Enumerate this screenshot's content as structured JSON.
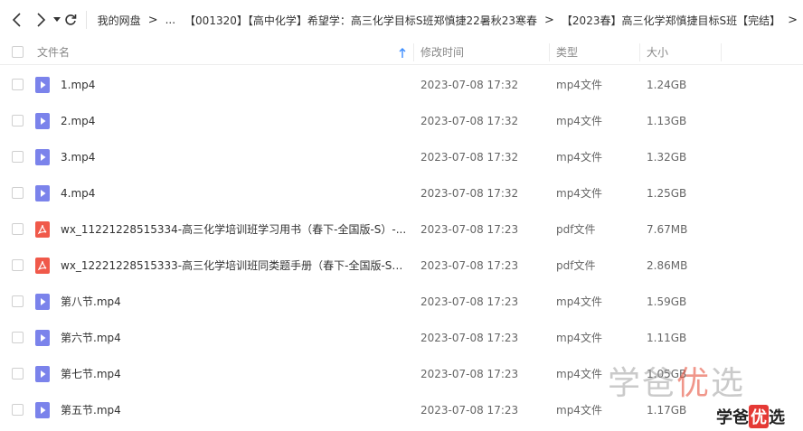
{
  "toolbar": {
    "back_icon": "back-arrow",
    "forward_icon": "forward-arrow",
    "dropdown_icon": "caret-down",
    "refresh_icon": "refresh"
  },
  "breadcrumb": {
    "items": [
      "我的网盘",
      "...",
      "【001320】【高中化学】希望学：高三化学目标S班郑慎捷22暑秋23寒春",
      "【2023春】高三化学郑慎捷目标S班【完结】"
    ]
  },
  "header": {
    "name": "文件名",
    "modified": "修改时间",
    "type": "类型",
    "size": "大小",
    "sort_icon": "sort-arrow-up"
  },
  "colors": {
    "video_icon": "#7b83eb",
    "pdf_icon": "#f0594a"
  },
  "files": [
    {
      "icon": "video-file",
      "name": "1.mp4",
      "modified": "2023-07-08 17:32",
      "type": "mp4文件",
      "size": "1.24GB"
    },
    {
      "icon": "video-file",
      "name": "2.mp4",
      "modified": "2023-07-08 17:32",
      "type": "mp4文件",
      "size": "1.13GB"
    },
    {
      "icon": "video-file",
      "name": "3.mp4",
      "modified": "2023-07-08 17:32",
      "type": "mp4文件",
      "size": "1.32GB"
    },
    {
      "icon": "video-file",
      "name": "4.mp4",
      "modified": "2023-07-08 17:32",
      "type": "mp4文件",
      "size": "1.25GB"
    },
    {
      "icon": "pdf-file",
      "name": "wx_11221228515334-高三化学培训班学习用书（春下-全国版-S）-...",
      "modified": "2023-07-08 17:23",
      "type": "pdf文件",
      "size": "7.67MB"
    },
    {
      "icon": "pdf-file",
      "name": "wx_12221228515333-高三化学培训班同类题手册（春下-全国版-S）...",
      "modified": "2023-07-08 17:23",
      "type": "pdf文件",
      "size": "2.86MB"
    },
    {
      "icon": "video-file",
      "name": "第八节.mp4",
      "modified": "2023-07-08 17:23",
      "type": "mp4文件",
      "size": "1.59GB"
    },
    {
      "icon": "video-file",
      "name": "第六节.mp4",
      "modified": "2023-07-08 17:23",
      "type": "mp4文件",
      "size": "1.11GB"
    },
    {
      "icon": "video-file",
      "name": "第七节.mp4",
      "modified": "2023-07-08 17:23",
      "type": "mp4文件",
      "size": "1.05GB"
    },
    {
      "icon": "video-file",
      "name": "第五节.mp4",
      "modified": "2023-07-08 17:23",
      "type": "mp4文件",
      "size": "1.17GB"
    }
  ],
  "watermark": {
    "large": "学爸",
    "large_highlight": "优",
    "large_tail": "选",
    "small": "学爸",
    "small_highlight": "优",
    "small_tail": "选"
  }
}
